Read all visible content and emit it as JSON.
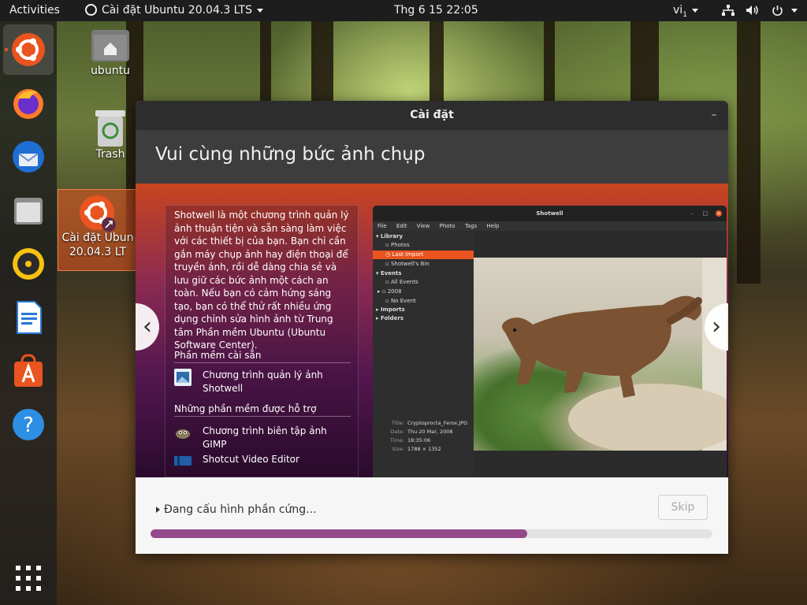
{
  "topbar": {
    "activities": "Activities",
    "app_menu": "Cài đặt Ubuntu 20.04.3 LTS",
    "clock": "Thg 6 15  22:05",
    "input_method": "vi",
    "input_method_subscript": "1"
  },
  "dock": {
    "apps": [
      {
        "name": "ubuntu-installer",
        "active": true
      },
      {
        "name": "firefox"
      },
      {
        "name": "thunderbird"
      },
      {
        "name": "files"
      },
      {
        "name": "rhythmbox"
      },
      {
        "name": "libreoffice-writer"
      },
      {
        "name": "ubuntu-software"
      },
      {
        "name": "help"
      }
    ],
    "show_apps_icon": "grid-icon"
  },
  "desktop": {
    "home_label": "ubuntu",
    "trash_label": "Trash",
    "installer_label_line1": "Cài đặt Ubun",
    "installer_label_line2": "20.04.3 LT"
  },
  "window": {
    "title": "Cài đặt",
    "minimize_glyph": "–",
    "heading": "Vui cùng những bức ảnh chụp",
    "slide": {
      "description": "Shotwell là một chương trình quản lý ảnh thuận tiện và sẵn sàng làm việc với các thiết bị của bạn. Bạn chỉ cần gắn máy chụp ảnh hay điện thoại để truyền ảnh, rồi dễ dàng chia sẻ và lưu giữ các bức ảnh một cách an toàn. Nếu bạn có cảm hứng sáng tạo, bạn có thể thử rất nhiều ứng dụng chỉnh sửa hình ảnh từ Trung tâm Phần mềm Ubuntu (Ubuntu Software Center).",
      "installed_heading": "Phần mềm cài sẵn",
      "installed_app": "Chương trình quản lý ảnh Shotwell",
      "supported_heading": "Những phần mềm được hỗ trợ",
      "supported_app_1": "Chương trình biên tập ảnh GIMP",
      "supported_app_2": "Shotcut Video Editor",
      "prev_glyph": "‹",
      "next_glyph": "›"
    },
    "shotwell": {
      "title": "Shotwell",
      "menu": [
        "File",
        "Edit",
        "View",
        "Photo",
        "Tags",
        "Help"
      ],
      "sidebar": {
        "library": "Library",
        "photos": "Photos",
        "last_import": "Last Import",
        "bin": "Shotwell's Bin",
        "events": "Events",
        "all_events": "All Events",
        "year": "2008",
        "no_event": "No Event",
        "imports": "Imports",
        "folders": "Folders"
      },
      "info": {
        "title_key": "Title:",
        "title_val": "Cryptoprocta_Ferox.JPG",
        "date_key": "Date:",
        "date_val": "Thu 20 Mar, 2008",
        "time_key": "Time:",
        "time_val": "18:35:06",
        "size_key": "Size:",
        "size_val": "1788 × 1352"
      }
    },
    "status": "Đang cấu hình phần cứng...",
    "skip": "Skip",
    "progress": 0.67
  },
  "colors": {
    "accent": "#e95420",
    "progress": "#94498b",
    "topbar": "#1d1d1d"
  }
}
